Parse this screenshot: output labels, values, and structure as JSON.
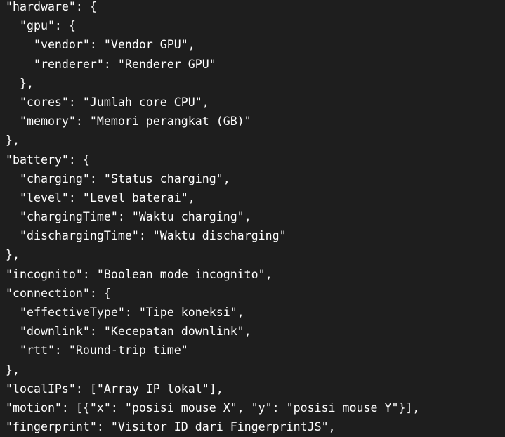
{
  "code_block": {
    "language": "json",
    "text_color": "#ffffff",
    "background_color": "#1e1e1e",
    "lines": [
      "\"hardware\": {",
      "  \"gpu\": {",
      "    \"vendor\": \"Vendor GPU\",",
      "    \"renderer\": \"Renderer GPU\"",
      "  },",
      "  \"cores\": \"Jumlah core CPU\",",
      "  \"memory\": \"Memori perangkat (GB)\"",
      "},",
      "\"battery\": {",
      "  \"charging\": \"Status charging\",",
      "  \"level\": \"Level baterai\",",
      "  \"chargingTime\": \"Waktu charging\",",
      "  \"dischargingTime\": \"Waktu discharging\"",
      "},",
      "\"incognito\": \"Boolean mode incognito\",",
      "\"connection\": {",
      "  \"effectiveType\": \"Tipe koneksi\",",
      "  \"downlink\": \"Kecepatan downlink\",",
      "  \"rtt\": \"Round-trip time\"",
      "},",
      "\"localIPs\": [\"Array IP lokal\"],",
      "\"motion\": [{\"x\": \"posisi mouse X\", \"y\": \"posisi mouse Y\"}],",
      "\"fingerprint\": \"Visitor ID dari FingerprintJS\","
    ]
  }
}
